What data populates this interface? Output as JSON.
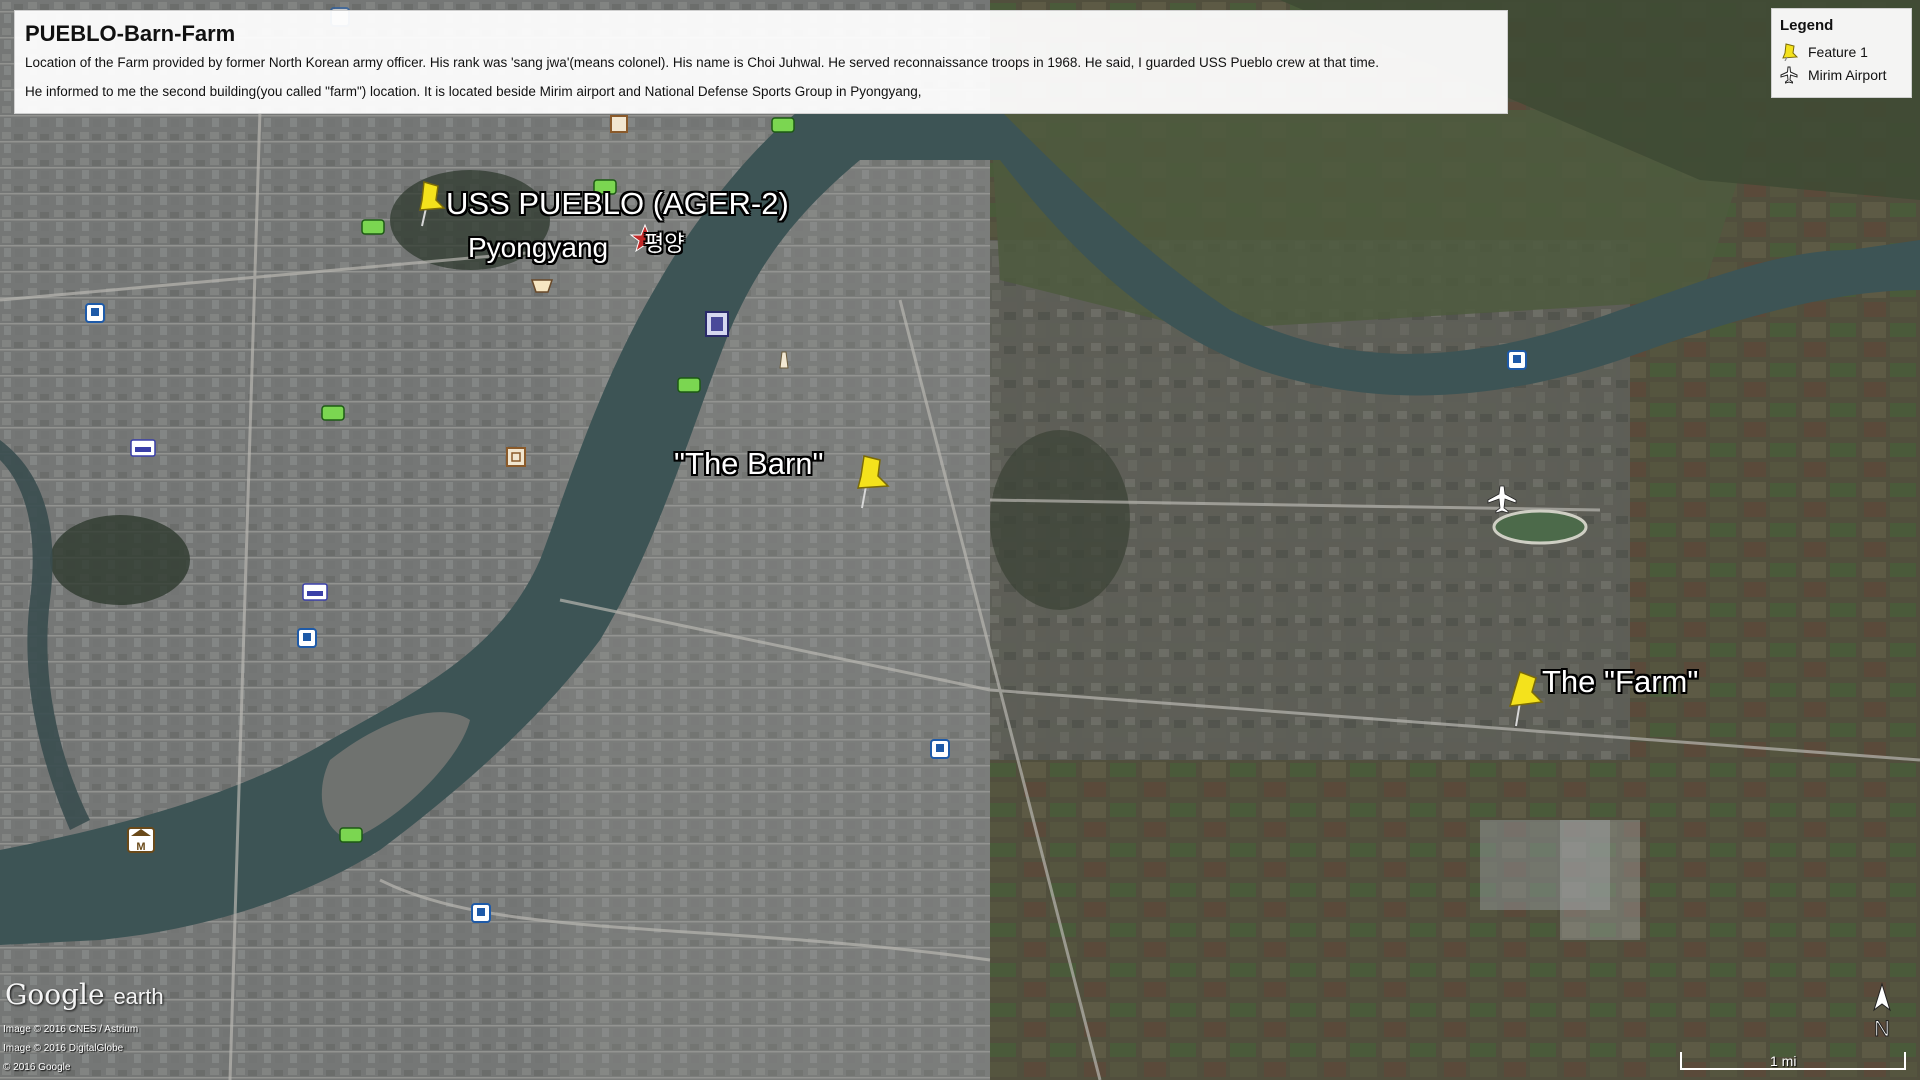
{
  "info": {
    "title": "PUEBLO-Barn-Farm",
    "line1": "Location of the Farm provided by former North Korean army officer. His rank was 'sang jwa'(means colonel). His name is Choi Juhwal. He served reconnaissance troops in 1968. He said, I guarded USS Pueblo crew at that time.",
    "line2": "He informed to me the second building(you called \"farm\") location. It is located beside Mirim airport and National Defense Sports Group in Pyongyang,"
  },
  "legend": {
    "title": "Legend",
    "items": [
      {
        "label": "Feature 1",
        "icon": "yellow-pushpin-icon"
      },
      {
        "label": "Mirim Airport",
        "icon": "airplane-icon"
      }
    ]
  },
  "labels": {
    "pueblo": "USS PUEBLO (AGER-2)",
    "pyongyang": "Pyongyang",
    "pyongyang_korean": "평양",
    "barn": "\"The Barn\"",
    "farm": "The \"Farm\""
  },
  "attribution": {
    "brand": "Google",
    "product": "earth",
    "copyright1": "Image © 2016 CNES / Astrium",
    "copyright2": "Image © 2016 DigitalGlobe",
    "copyright3": "© 2016 Google"
  },
  "scale": {
    "label": "1 mi"
  },
  "compass": {
    "label": "N"
  },
  "colors": {
    "pin": "#f4e21c",
    "river": "#3e5657",
    "urban": "#787a79",
    "farmland": "#4f4f3c"
  }
}
